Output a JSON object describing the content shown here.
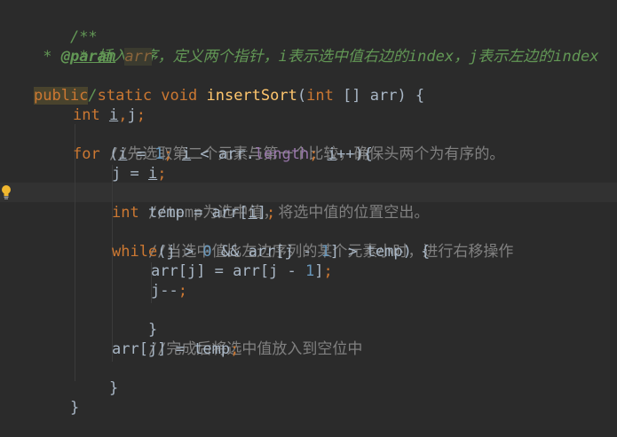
{
  "editor": {
    "theme": "dark",
    "colors": {
      "background": "#2b2b2b",
      "keyword": "#cc7832",
      "number": "#6897bb",
      "field": "#9876aa",
      "method": "#ffc66d",
      "comment": "#808080",
      "doc_comment": "#629755",
      "text": "#a9b7c6"
    },
    "gutter_icon": "lightbulb-icon",
    "lines": {
      "l1": {
        "a": "/**"
      },
      "l2": {
        "a": " * 插入排序，定义两个指针，i表示选中值右边的index，j表示左边的index"
      },
      "l3": {
        "a": " * ",
        "tag": "@param",
        "param": "arr"
      },
      "l4": {
        "a": " */"
      },
      "l5": {
        "a": "public",
        "b": " static void ",
        "c": "insertSort",
        "d": "(",
        "e": "int",
        "f": " [] arr) {"
      },
      "l6": {
        "a": "int ",
        "b": "i",
        "c": ",",
        "d": "j",
        "e": ";"
      },
      "l7": {
        "a": "//先选取第二个元素与第一个比较，确保头两个为有序的。"
      },
      "l8": {
        "a": "for",
        "b": " (",
        "c": "i",
        "d": " = ",
        "e": "1",
        "f": "; ",
        "g": "i",
        "h": " < arr.",
        "i": "length",
        "j": "; ",
        "k": "i",
        "l": "++){"
      },
      "l9": {
        "a": "j",
        "b": " = ",
        "c": "i",
        "d": ";"
      },
      "l10": {
        "a": "//temp为选中值，将选中值的位置空出。"
      },
      "l11": {
        "a": "int",
        "b": " temp = arr[",
        "c": "i",
        "d": "]",
        "e": ";"
      },
      "l12": {
        "a": "//当选中值比左边序列的某个元素小时，进行右移操作"
      },
      "l13": {
        "a": "while",
        "b": "(j > ",
        "c": "0",
        "d": " && arr[j - ",
        "e": "1",
        "f": "] > temp) {"
      },
      "l14": {
        "a": "arr[j] = arr[j - ",
        "b": "1",
        "c": "]",
        "d": ";"
      },
      "l15": {
        "a": "j--",
        "b": ";"
      },
      "l16": {
        "a": "}"
      },
      "l17": {
        "a": "//完成后将选中值放入到空位中"
      },
      "l18": {
        "a": "arr[j] = temp",
        "b": ";"
      },
      "l19": {
        "a": "}"
      },
      "l20": {
        "a": "}"
      }
    }
  }
}
